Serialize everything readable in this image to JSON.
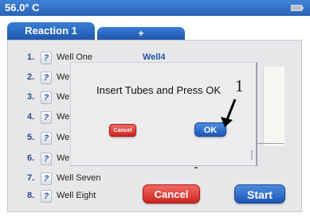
{
  "status_bar": {
    "temperature": "56.0° C"
  },
  "tabs": {
    "active": "Reaction 1",
    "add": "+"
  },
  "wells": [
    {
      "num": "1.",
      "help": "?",
      "name": "Well One"
    },
    {
      "num": "2.",
      "help": "?",
      "name": "We"
    },
    {
      "num": "3.",
      "help": "?",
      "name": "We"
    },
    {
      "num": "4.",
      "help": "?",
      "name": "We"
    },
    {
      "num": "5.",
      "help": "?",
      "name": "We"
    },
    {
      "num": "6.",
      "help": "?",
      "name": "We"
    },
    {
      "num": "7.",
      "help": "?",
      "name": "Well Seven"
    },
    {
      "num": "8.",
      "help": "?",
      "name": "Well Eight"
    }
  ],
  "well_value": "Well4",
  "buttons": {
    "cancel": "Cancel",
    "start": "Start"
  },
  "dialog": {
    "message": "Insert Tubes and Press OK",
    "cancel": "Cancel",
    "ok": "OK"
  },
  "annotation": {
    "label": "1"
  },
  "colors": {
    "accent_blue": "#2a63b4",
    "cancel_red": "#cf2320"
  }
}
